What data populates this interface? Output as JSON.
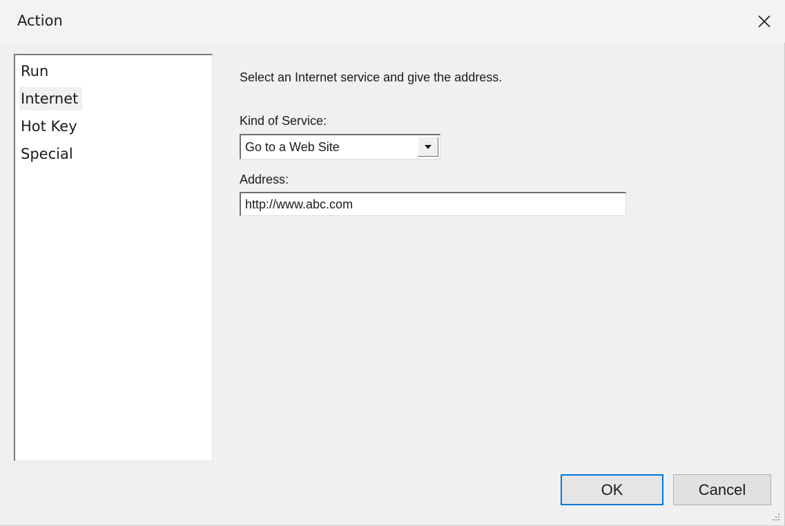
{
  "window": {
    "title": "Action",
    "close_icon": "close-icon"
  },
  "categories": {
    "items": [
      {
        "label": "Run"
      },
      {
        "label": "Internet",
        "selected": true
      },
      {
        "label": "Hot Key"
      },
      {
        "label": "Special"
      }
    ]
  },
  "internet_panel": {
    "instruction": "Select an Internet service and give the address.",
    "kind_label": "Kind of Service:",
    "kind_value": "Go to a Web Site",
    "address_label": "Address:",
    "address_value": "http://www.abc.com"
  },
  "buttons": {
    "ok": "OK",
    "cancel": "Cancel"
  },
  "colors": {
    "dialog_bg": "#f0f0f0",
    "default_button_border": "#0078d7"
  }
}
